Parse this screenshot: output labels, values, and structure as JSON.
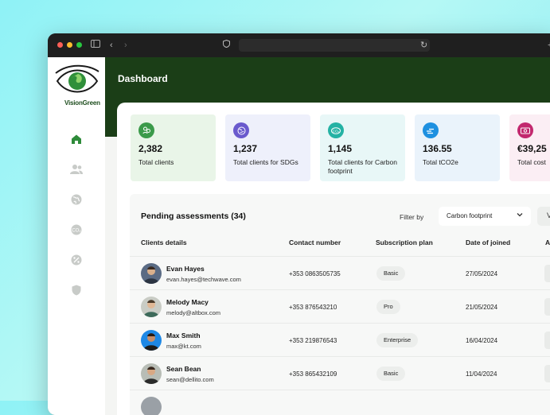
{
  "app": {
    "logo_text": "VisionGreen"
  },
  "header": {
    "title": "Dashboard"
  },
  "sidebar": {
    "items": [
      {
        "icon": "home-icon",
        "active": true
      },
      {
        "icon": "users-icon"
      },
      {
        "icon": "globe-icon"
      },
      {
        "icon": "carbon-icon"
      },
      {
        "icon": "percent-icon"
      },
      {
        "icon": "shield-icon"
      }
    ]
  },
  "stats": [
    {
      "value": "2,382",
      "label": "Total clients",
      "icon": "people-icon",
      "bg": "#e9f5e8",
      "icon_bg": "#3b9a4a"
    },
    {
      "value": "1,237",
      "label": "Total clients for SDGs",
      "icon": "globe-icon",
      "bg": "#eef0fb",
      "icon_bg": "#6a5acd"
    },
    {
      "value": "1,145",
      "label": "Total clients for Carbon footprint",
      "icon": "co2-icon",
      "bg": "#e8f7f7",
      "icon_bg": "#24b2a4"
    },
    {
      "value": "136.55",
      "label": "Total tCO2e",
      "icon": "cloud-icon",
      "bg": "#eaf3fb",
      "icon_bg": "#1e90e0"
    },
    {
      "value": "€39,25",
      "label": "Total cost",
      "icon": "money-icon",
      "bg": "#fbeef4",
      "icon_bg": "#c2286e"
    }
  ],
  "table": {
    "title": "Pending assessments (34)",
    "filter_label": "Filter by",
    "filter_value": "Carbon footprint",
    "extra_button": "V",
    "headers": [
      "Clients details",
      "Contact number",
      "Subscription plan",
      "Date of joined",
      "A"
    ],
    "rows": [
      {
        "name": "Evan Hayes",
        "email": "evan.hayes@techwave.com",
        "phone": "+353 0863505735",
        "plan": "Basic",
        "date": "27/05/2024"
      },
      {
        "name": "Melody Macy",
        "email": "melody@altbox.com",
        "phone": "+353 876543210",
        "plan": "Pro",
        "date": "21/05/2024"
      },
      {
        "name": "Max Smith",
        "email": "max@kt.com",
        "phone": "+353 219876543",
        "plan": "Enterprise",
        "date": "16/04/2024"
      },
      {
        "name": "Sean Bean",
        "email": "sean@dellito.com",
        "phone": "+353 865432109",
        "plan": "Basic",
        "date": "11/04/2024"
      }
    ]
  }
}
